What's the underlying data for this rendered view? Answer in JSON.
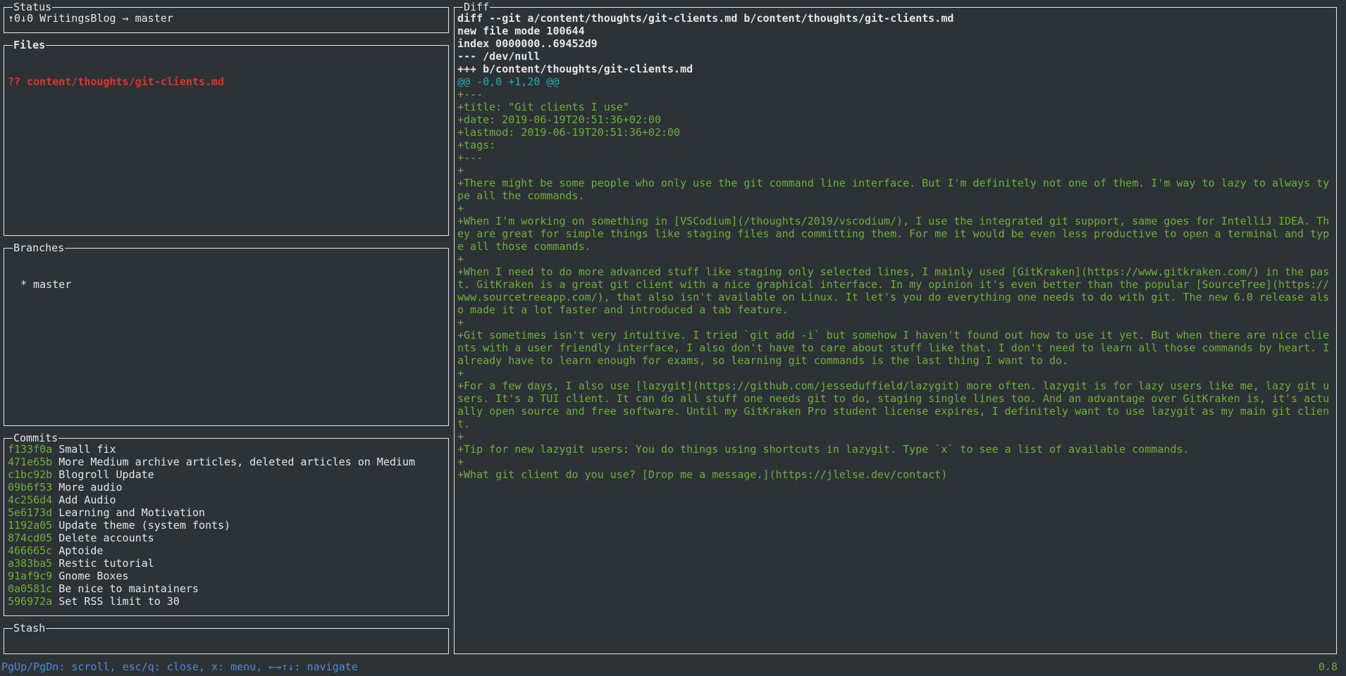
{
  "status": {
    "title": "Status",
    "text": "↑0↓0 WritingsBlog → master"
  },
  "files": {
    "title": "Files",
    "items": [
      "?? content/thoughts/git-clients.md"
    ]
  },
  "branches": {
    "title": "Branches",
    "items": [
      "* master"
    ]
  },
  "commits": {
    "title": "Commits",
    "items": [
      {
        "sha": "f133f0a",
        "msg": "Small fix"
      },
      {
        "sha": "471e65b",
        "msg": "More Medium archive articles, deleted articles on Medium"
      },
      {
        "sha": "c1bc92b",
        "msg": "Blogroll Update"
      },
      {
        "sha": "09b6f53",
        "msg": "More audio"
      },
      {
        "sha": "4c256d4",
        "msg": "Add Audio"
      },
      {
        "sha": "5e6173d",
        "msg": "Learning and Motivation"
      },
      {
        "sha": "1192a05",
        "msg": "Update theme (system fonts)"
      },
      {
        "sha": "874cd05",
        "msg": "Delete accounts"
      },
      {
        "sha": "466665c",
        "msg": "Aptoide"
      },
      {
        "sha": "a383ba5",
        "msg": "Restic tutorial"
      },
      {
        "sha": "91af9c9",
        "msg": "Gnome Boxes"
      },
      {
        "sha": "0a0581c",
        "msg": "Be nice to maintainers"
      },
      {
        "sha": "596972a",
        "msg": "Set RSS limit to 30"
      }
    ]
  },
  "stash": {
    "title": "Stash"
  },
  "diff": {
    "title": "Diff",
    "header_lines": [
      "diff --git a/content/thoughts/git-clients.md b/content/thoughts/git-clients.md",
      "new file mode 100644",
      "index 0000000..69452d9",
      "--- /dev/null",
      "+++ b/content/thoughts/git-clients.md"
    ],
    "hunk": "@@ -0,0 +1,20 @@",
    "added_lines": [
      "+---",
      "+title: \"Git clients I use\"",
      "+date: 2019-06-19T20:51:36+02:00",
      "+lastmod: 2019-06-19T20:51:36+02:00",
      "+tags:",
      "+---",
      "+",
      "+There might be some people who only use the git command line interface. But I'm definitely not one of them. I'm way to lazy to always type all the commands.",
      "+",
      "+When I'm working on something in [VSCodium](/thoughts/2019/vscodium/), I use the integrated git support, same goes for IntelliJ IDEA. They are great for simple things like staging files and committing them. For me it would be even less productive to open a terminal and type all those commands.",
      "+",
      "+When I need to do more advanced stuff like staging only selected lines, I mainly used [GitKraken](https://www.gitkraken.com/) in the past. GitKraken is a great git client with a nice graphical interface. In my opinion it's even better than the popular [SourceTree](https://www.sourcetreeapp.com/), that also isn't available on Linux. It let's you do everything one needs to do with git. The new 6.0 release also made it a lot faster and introduced a tab feature.",
      "+",
      "+Git sometimes isn't very intuitive. I tried `git add -i` but somehow I haven't found out how to use it yet. But when there are nice clients with a user friendly interface, I also don't have to care about stuff like that. I don't need to learn all those commands by heart. I already have to learn enough for exams, so learning git commands is the last thing I want to do.",
      "+",
      "+For a few days, I also use [lazygit](https://github.com/jesseduffield/lazygit) more often. lazygit is for lazy users like me, lazy git users. It's a TUI client. It can do all stuff one needs git to do, staging single lines too. And an advantage over GitKraken is, it's actually open source and free software. Until my GitKraken Pro student license expires, I definitely want to use lazygit as my main git client.",
      "+",
      "+Tip for new lazygit users: You do things using shortcuts in lazygit. Type `x` to see a list of available commands.",
      "+",
      "+What git client do you use? [Drop me a message.](https://jlelse.dev/contact)"
    ]
  },
  "footer": {
    "help": "PgUp/PgDn: scroll, esc/q: close, x: menu, ←→↑↓: navigate",
    "version": "0.8"
  },
  "colors": {
    "background": "#2d3237",
    "untracked_file": "#e0312b",
    "added_line": "#6fae3a",
    "hunk_header": "#24a8b5",
    "footer_help": "#4f8bd4"
  }
}
